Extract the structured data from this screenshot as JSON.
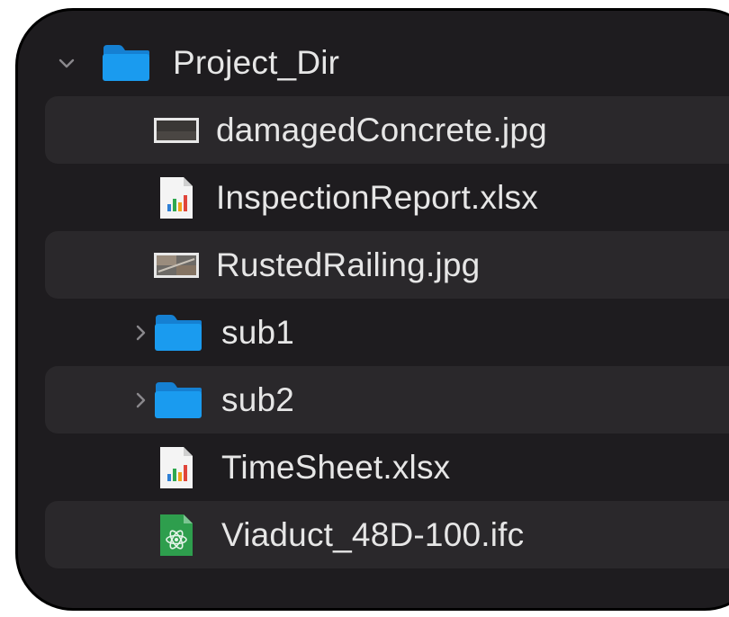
{
  "finder": {
    "root": {
      "name": "Project_Dir",
      "expanded": true,
      "icon": "folder-icon"
    },
    "items": [
      {
        "name": "damagedConcrete.jpg",
        "icon": "image-file-icon",
        "type": "file"
      },
      {
        "name": "InspectionReport.xlsx",
        "icon": "spreadsheet-file-icon",
        "type": "file"
      },
      {
        "name": "RustedRailing.jpg",
        "icon": "image-file-icon",
        "type": "file"
      },
      {
        "name": "sub1",
        "icon": "folder-icon",
        "type": "folder",
        "expanded": false
      },
      {
        "name": "sub2",
        "icon": "folder-icon",
        "type": "folder",
        "expanded": false
      },
      {
        "name": "TimeSheet.xlsx",
        "icon": "spreadsheet-file-icon",
        "type": "file"
      },
      {
        "name": "Viaduct_48D-100.ifc",
        "icon": "ifc-file-icon",
        "type": "file"
      }
    ]
  },
  "colors": {
    "background": "#1e1c1f",
    "alt_row": "#2a282b",
    "text": "#e6e6e6",
    "folder": "#1a9bef",
    "chevron": "#8a888c"
  }
}
